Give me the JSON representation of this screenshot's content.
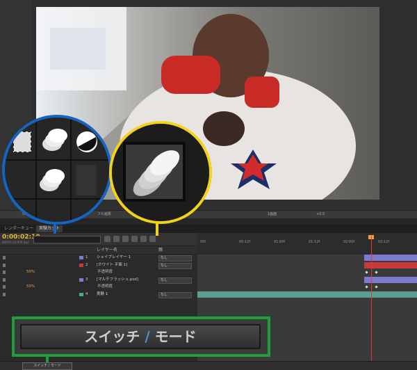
{
  "colors": {
    "accent_timecode": "#e9b733",
    "highlight_blue": "#1565c0",
    "highlight_yellow": "#f2d21a",
    "highlight_green": "#1e9e3c",
    "cti_red": "#e23b2c"
  },
  "viewer": {
    "status": [
      "50%",
      "フル画質",
      "1画面",
      "+0.0"
    ]
  },
  "panel_tabs": [
    "レンダーキュー",
    "実験カット"
  ],
  "timeline": {
    "timecode": "0:00:02:10",
    "fps_info": "00070 (23.976 fps)",
    "column_header": "レイヤー名",
    "parent_header": "親",
    "ruler_ticks": [
      "00f",
      "00:12f",
      "01:00f",
      "01:12f",
      "02:00f",
      "02:12f"
    ],
    "layers": [
      {
        "num": "1",
        "name": "シェイプレイヤー 1",
        "mode": "なし",
        "color": "#7b7bd0",
        "sub": false,
        "val": ""
      },
      {
        "num": "2",
        "name": "[ホワイト 平面 1]",
        "mode": "なし",
        "color": "#c83a3a",
        "sub": false,
        "val": ""
      },
      {
        "num": "",
        "name": "不透明度",
        "mode": "",
        "color": "",
        "sub": true,
        "val": "50%"
      },
      {
        "num": "3",
        "name": "[マルチフラッシュ.psd]",
        "mode": "なし",
        "color": "#7b7bd0",
        "sub": false,
        "val": ""
      },
      {
        "num": "",
        "name": "不透明度",
        "mode": "",
        "color": "",
        "sub": true,
        "val": "50%"
      },
      {
        "num": "4",
        "name": "実験 1",
        "mode": "なし",
        "color": "#4aa89a",
        "sub": false,
        "val": ""
      }
    ]
  },
  "icons": [
    "motion-blur-icon",
    "frame-blend-icon",
    "adjustment-layer-icon"
  ],
  "toggle": {
    "left": "スイッチ",
    "slash": "/",
    "right": "モード",
    "small": "スイッチ / モード"
  }
}
